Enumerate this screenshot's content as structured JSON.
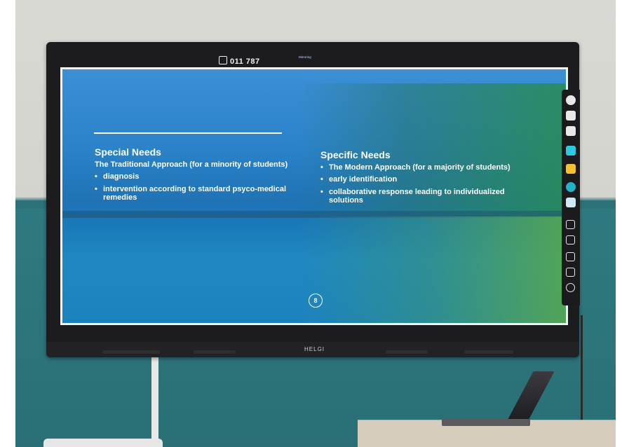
{
  "display": {
    "room_code": "011 787",
    "mirroring_label": "Mirroring",
    "brand": "HELGI"
  },
  "slide": {
    "left": {
      "heading": "Special Needs",
      "subheading": "The Traditional Approach (for a minority of students)",
      "bullets": [
        "diagnosis",
        "intervention according to standard psyco-medical remedies"
      ]
    },
    "right": {
      "heading": "Specific Needs",
      "subheading": "The Modern Approach (for a majority of students)",
      "bullets": [
        "early identification",
        "collaborative response leading to individualized solutions"
      ]
    },
    "page_number": "8"
  },
  "toolbar": {
    "tools": [
      {
        "name": "settings-icon",
        "color": "#e8e8e8",
        "shape": "round"
      },
      {
        "name": "home-icon",
        "color": "#e8e8e8",
        "shape": "square"
      },
      {
        "name": "window-icon",
        "color": "#e8e8e8",
        "shape": "square"
      },
      {
        "name": "app-cyan-icon",
        "color": "#2ec9e0",
        "shape": "square"
      },
      {
        "name": "app-yellow-icon",
        "color": "#f2c230",
        "shape": "square"
      },
      {
        "name": "app-teal-icon",
        "color": "#21b4c8",
        "shape": "round"
      },
      {
        "name": "app-light-icon",
        "color": "#cfe9f7",
        "shape": "square"
      },
      {
        "name": "screen-share-icon",
        "color": "#e8e8e8",
        "shape": "outline"
      },
      {
        "name": "pen-icon",
        "color": "#e8e8e8",
        "shape": "outline"
      },
      {
        "name": "tablet-icon",
        "color": "#e8e8e8",
        "shape": "outline"
      },
      {
        "name": "hourglass-icon",
        "color": "#e8e8e8",
        "shape": "outline"
      },
      {
        "name": "minus-icon",
        "color": "#e8e8e8",
        "shape": "round-outline"
      }
    ]
  }
}
